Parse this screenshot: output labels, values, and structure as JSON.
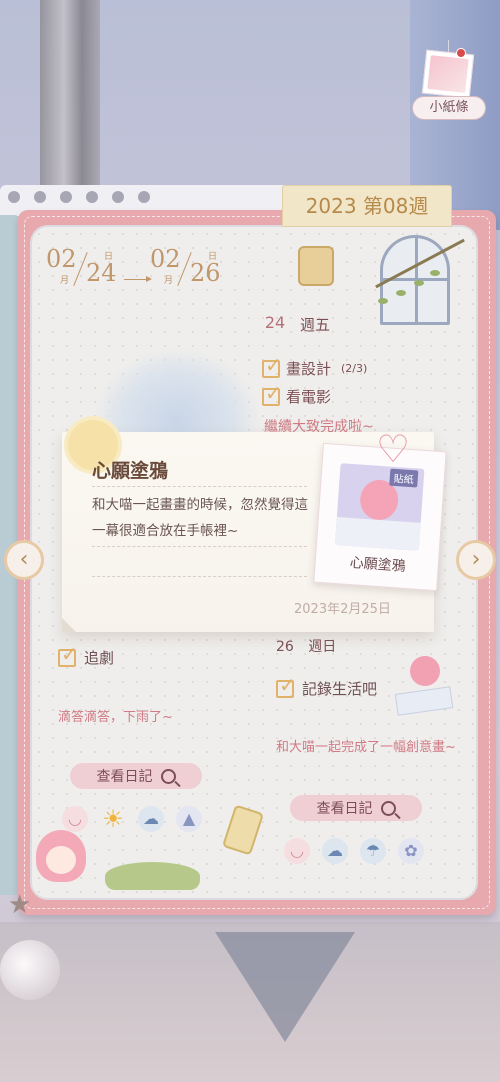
{
  "header": {
    "note_label": "小紙條",
    "week_tab": "2023 第08週"
  },
  "date_range": {
    "start_month": "02",
    "start_day": "24",
    "end_month": "02",
    "end_day": "26",
    "month_unit": "月",
    "day_unit": "日"
  },
  "friday": {
    "day_number": "24",
    "day_label": "週五",
    "tasks": [
      {
        "label": "畫設計",
        "progress": "(2/3)"
      },
      {
        "label": "看電影",
        "progress": ""
      }
    ],
    "memo": "繼續大致完成啦~"
  },
  "left_column": {
    "task": "追劇",
    "memo": "滴答滴答，下雨了~",
    "view_button": "查看日記"
  },
  "sunday": {
    "day_number": "26",
    "day_label": "週日",
    "task": "記錄生活吧",
    "memo": "和大喵一起完成了一幅創意畫~",
    "view_button": "查看日記"
  },
  "memo_card": {
    "title": "心願塗鴉",
    "body": "和大喵一起畫畫的時候，忽然覺得這一幕很適合放在手帳裡~",
    "date": "2023年2月25日",
    "photo_tag": "貼紙",
    "photo_caption": "心願塗鴉"
  },
  "nav": {
    "prev_icon": "chevron-left-icon",
    "next_icon": "chevron-right-icon"
  },
  "colors": {
    "cover": "#e7a9ad",
    "accent_gold": "#c0976a",
    "memo_pink": "#d07a84"
  }
}
